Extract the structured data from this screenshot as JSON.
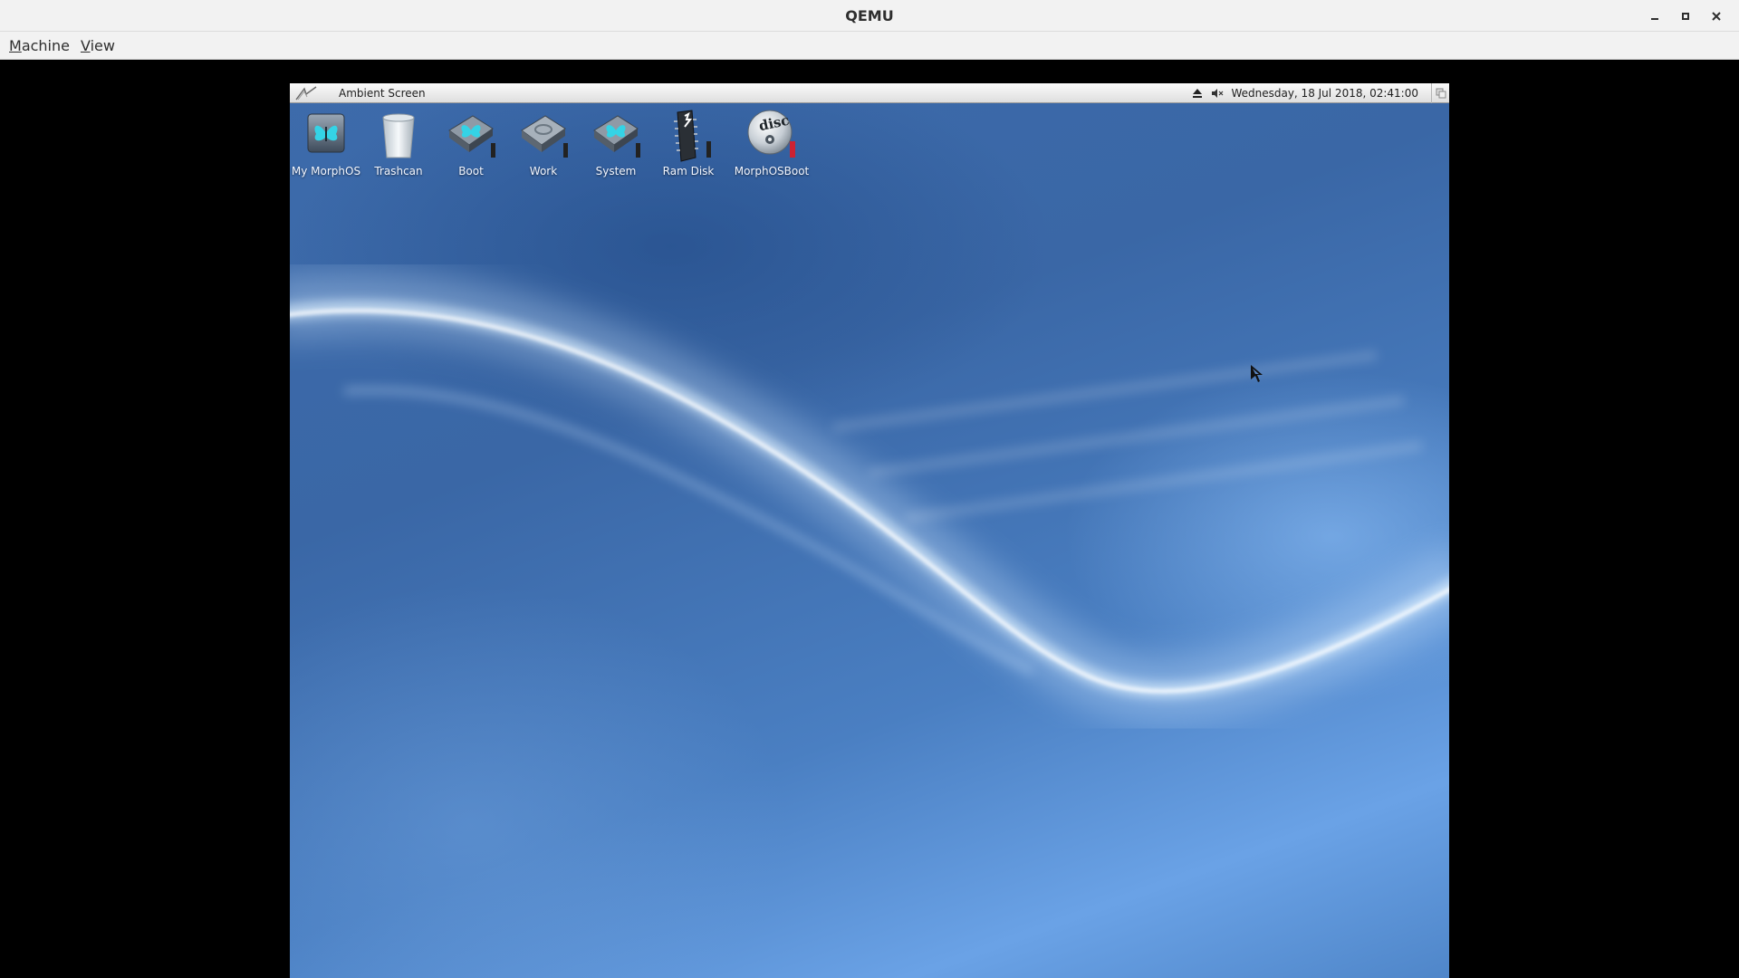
{
  "host": {
    "title": "QEMU",
    "menu": [
      {
        "mnemonic": "M",
        "rest": "achine"
      },
      {
        "mnemonic": "V",
        "rest": "iew"
      }
    ],
    "controls": [
      "minimize-icon",
      "maximize-icon",
      "close-icon"
    ]
  },
  "guest": {
    "screen_title": "Ambient Screen",
    "clock": "Wednesday, 18 Jul 2018, 02:41:00",
    "tray_icons": [
      "eject-icon",
      "speaker-muted-icon"
    ],
    "desktop_icons": [
      {
        "label": "My MorphOS",
        "icon": "my-morphos-icon"
      },
      {
        "label": "Trashcan",
        "icon": "trashcan-icon"
      },
      {
        "label": "Boot",
        "icon": "hard-drive-icon"
      },
      {
        "label": "Work",
        "icon": "hard-drive-icon"
      },
      {
        "label": "System",
        "icon": "hard-drive-icon"
      },
      {
        "label": "Ram Disk",
        "icon": "ram-disk-icon"
      },
      {
        "label": "MorphOSBoot",
        "icon": "cd-disc-icon"
      }
    ],
    "colors": {
      "wallpaper": "#3d6bab",
      "wave_highlight": "#d8eeff",
      "volume_bar": "#222222",
      "volume_bar_cd": "#cc2233"
    }
  }
}
